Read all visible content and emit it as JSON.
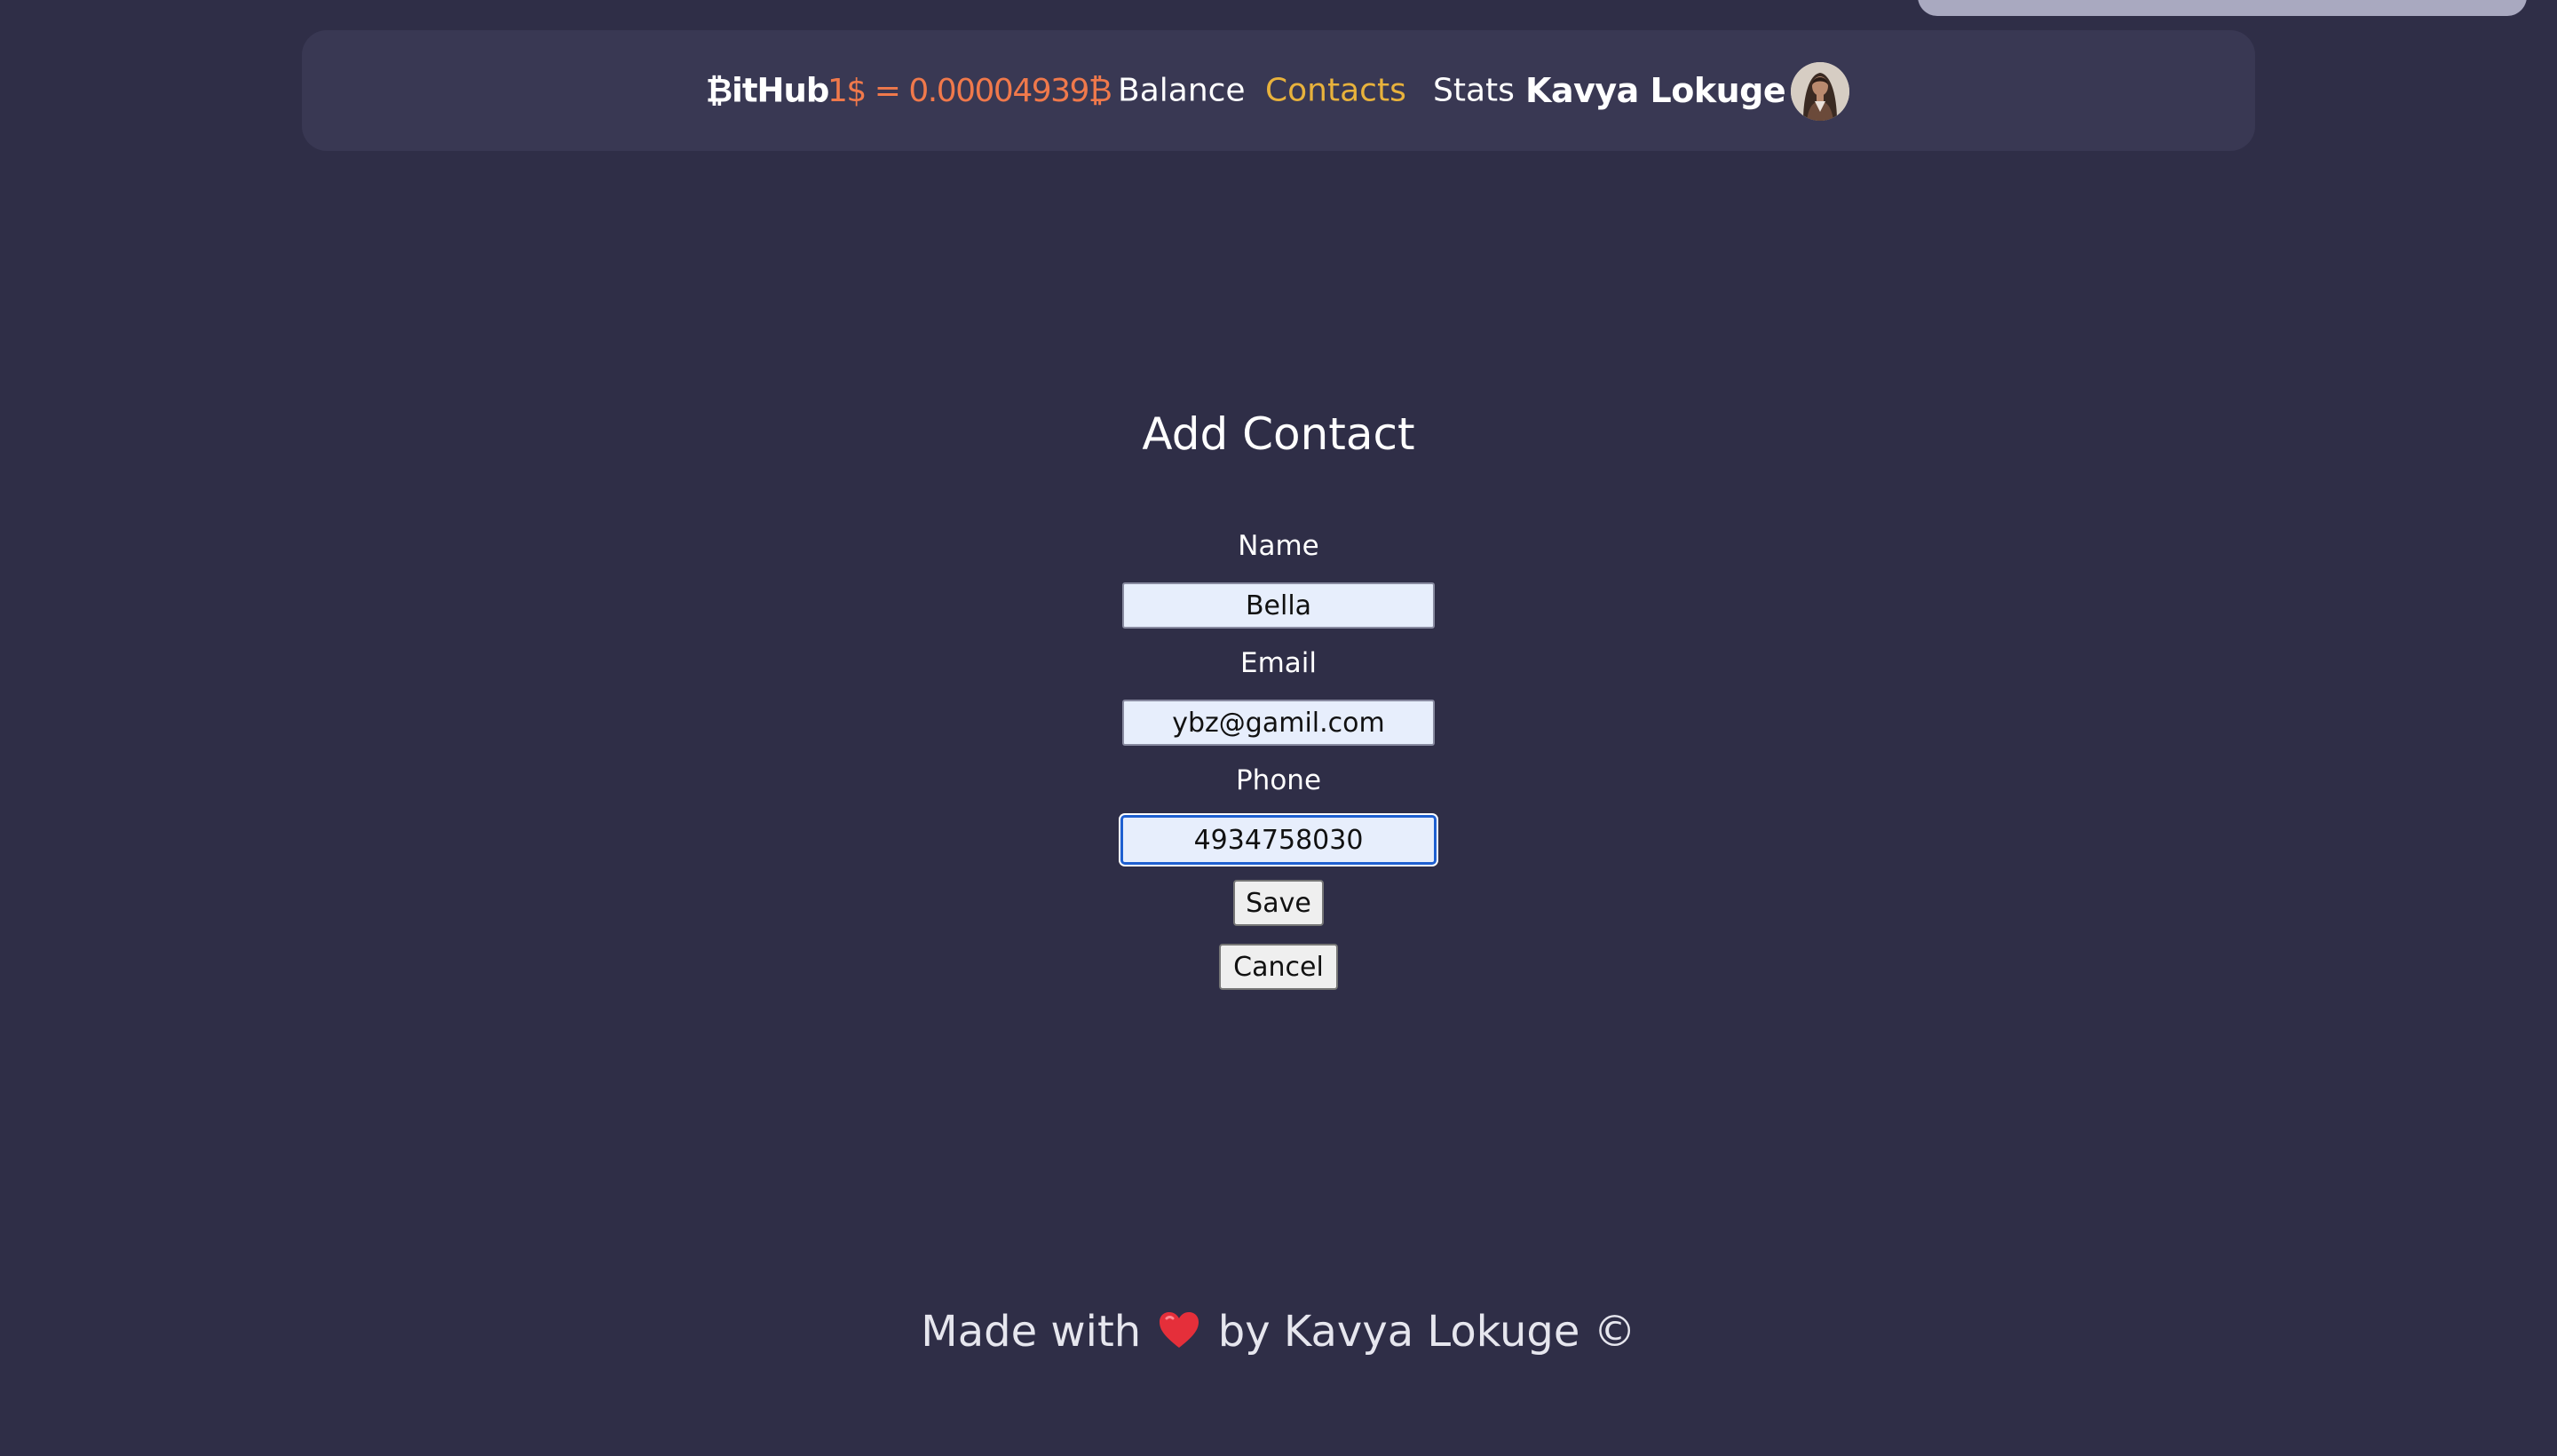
{
  "colors": {
    "background": "#2f2e47",
    "navbar": "#393853",
    "rate": "#f0794b",
    "active_link": "#e8b23c",
    "input_background": "#e7eefc",
    "focus_border": "#1e5fd0"
  },
  "navbar": {
    "logo": "₿itHub",
    "rate": "1$ = 0.00004939₿",
    "links": [
      {
        "label": "Balance",
        "active": false
      },
      {
        "label": "Contacts",
        "active": true
      },
      {
        "label": "Stats",
        "active": false
      }
    ],
    "user_name": "Kavya Lokuge",
    "avatar_icon": "user-avatar"
  },
  "form": {
    "title": "Add Contact",
    "fields": [
      {
        "label": "Name",
        "value": "Bella"
      },
      {
        "label": "Email",
        "value": "ybz@gamil.com"
      },
      {
        "label": "Phone",
        "value": "4934758030",
        "focused": true
      }
    ],
    "save_label": "Save",
    "cancel_label": "Cancel"
  },
  "footer": {
    "prefix": "Made with",
    "icon": "heart-icon",
    "suffix": "by Kavya Lokuge ©"
  }
}
